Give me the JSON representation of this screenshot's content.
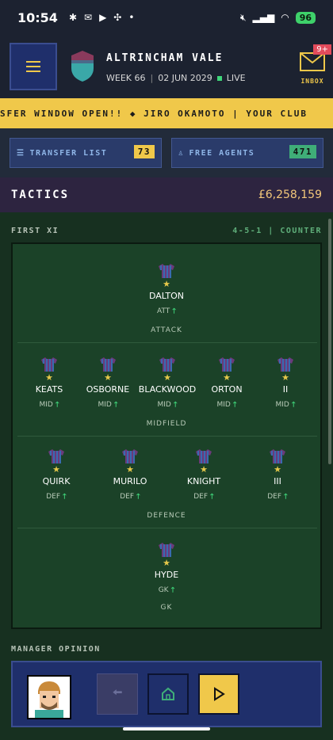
{
  "status_bar": {
    "time": "10:54",
    "battery": "96"
  },
  "header": {
    "club_name": "ALTRINCHAM VALE",
    "week": "WEEK 66",
    "date": "02 JUN 2029",
    "live_label": "LIVE",
    "inbox_label": "INBOX",
    "inbox_badge": "9+"
  },
  "ticker": {
    "text": "SFER WINDOW OPEN!!   ◆   JIRO OKAMOTO | YOUR CLUB"
  },
  "actions": {
    "transfer_list_label": "TRANSFER LIST",
    "transfer_list_count": "73",
    "free_agents_label": "FREE AGENTS",
    "free_agents_count": "471"
  },
  "tactics": {
    "title": "TACTICS",
    "budget": "£6,258,159"
  },
  "lineup": {
    "heading": "FIRST XI",
    "formation": "4-5-1 | COUNTER",
    "zones": {
      "attack": "ATTACK",
      "midfield": "MIDFIELD",
      "defence": "DEFENCE",
      "gk": "GK"
    },
    "attack": [
      {
        "name": "DALTON",
        "pos": "ATT"
      }
    ],
    "midfield": [
      {
        "name": "KEATS",
        "pos": "MID"
      },
      {
        "name": "OSBORNE",
        "pos": "MID"
      },
      {
        "name": "BLACKWOOD",
        "pos": "MID"
      },
      {
        "name": "ORTON",
        "pos": "MID"
      },
      {
        "name": "II",
        "pos": "MID"
      }
    ],
    "defence": [
      {
        "name": "QUIRK",
        "pos": "DEF"
      },
      {
        "name": "MURILO",
        "pos": "DEF"
      },
      {
        "name": "KNIGHT",
        "pos": "DEF"
      },
      {
        "name": "III",
        "pos": "DEF"
      }
    ],
    "goalkeeper": [
      {
        "name": "HYDE",
        "pos": "GK"
      }
    ]
  },
  "manager_opinion": {
    "label": "MANAGER OPINION"
  },
  "colors": {
    "accent": "#f0c84a",
    "pitch": "#1b4228",
    "nav": "#1f2f6b",
    "live": "#3fd67a",
    "budget": "#f3c77a"
  }
}
